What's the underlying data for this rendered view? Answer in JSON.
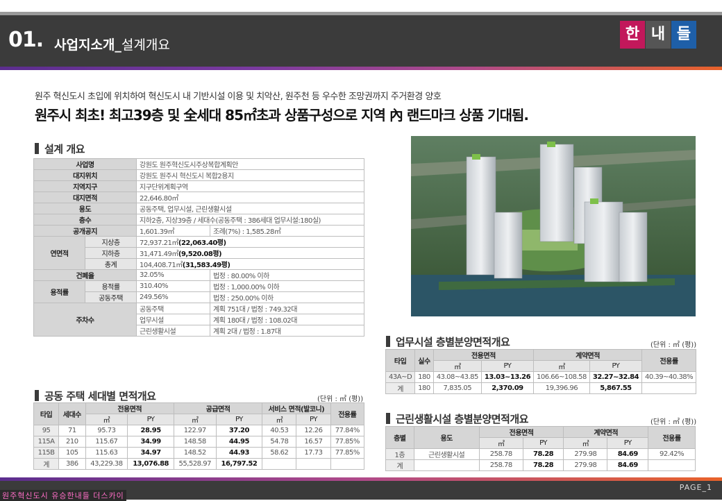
{
  "header": {
    "number": "01.",
    "title": "사업지소개_",
    "subtitle": "설계개요",
    "logo": [
      "한",
      "내",
      "들"
    ]
  },
  "intro": {
    "line1": "원주 혁신도시 초입에 위치하여 혁신도시 내 기반시설 이용 및 치악산, 원주천 등 우수한 조망권까지 주거환경 양호",
    "line2": "원주시 최초! 최고39층 및 全세대 85㎡초과 상품구성으로 지역 內 랜드마크 상품 기대됨."
  },
  "overview": {
    "title": "설계 개요",
    "rows": [
      {
        "label": "사업명",
        "value": "강원도 원주혁신도시주상복합계획안"
      },
      {
        "label": "대지위치",
        "value": "강원도 원주시 혁신도시 복합2용지"
      },
      {
        "label": "지역지구",
        "value": "지구단위계획구역"
      },
      {
        "label": "대지면적",
        "value": "22,646.80㎡"
      },
      {
        "label": "용도",
        "value": "공동주택, 업무시설, 근린생활시설"
      },
      {
        "label": "층수",
        "value": "지하2층, 지상39층 / 세대수(공동주택 : 386세대 업무시설:180실)"
      }
    ],
    "public_space": {
      "label": "공개공지",
      "value": "1,601.39㎡",
      "extra": "조례(7%) : 1,585.28㎡"
    },
    "floor_area": {
      "label": "연면적",
      "items": [
        {
          "label": "지상층",
          "value": "72,937.21㎡",
          "bold": "(22,063.40평)"
        },
        {
          "label": "지하층",
          "value": "31,471.49㎡",
          "bold": "(9,520.08평)"
        },
        {
          "label": "총계",
          "value": "104,408.71㎡",
          "bold": "(31,583.49평)"
        }
      ]
    },
    "coverage": {
      "label": "건폐율",
      "value": "32.05%",
      "legal": "법정 : 80.00% 이하"
    },
    "far": {
      "label": "용적률",
      "items": [
        {
          "label": "용적률",
          "value": "310.40%",
          "legal": "법정 : 1,000.00% 이하"
        },
        {
          "label": "공동주택",
          "value": "249.56%",
          "legal": "법정 : 250.00% 이하"
        }
      ]
    },
    "parking": {
      "label": "주차수",
      "items": [
        {
          "use": "공동주택",
          "value": "계획 751대 / 법정 : 749.32대"
        },
        {
          "use": "업무시설",
          "value": "계획 180대 / 법정 : 108.02대"
        },
        {
          "use": "근린생활시설",
          "value": "계획 2대 / 법정 : 1.87대"
        }
      ]
    }
  },
  "housing": {
    "title": "공동 주택 세대별 면적개요",
    "unit": "(단위 : ㎡ (평))",
    "headers": [
      "타입",
      "세대수",
      "전용면적",
      "공급면적",
      "서비스 면적(발코니)",
      "전용률"
    ],
    "sub": [
      "㎡",
      "PY",
      "㎡",
      "PY",
      "㎡",
      "PY"
    ],
    "rows": [
      [
        "95",
        "71",
        "95.73",
        "28.95",
        "122.97",
        "37.20",
        "40.53",
        "12.26",
        "77.84%"
      ],
      [
        "115A",
        "210",
        "115.67",
        "34.99",
        "148.58",
        "44.95",
        "54.78",
        "16.57",
        "77.85%"
      ],
      [
        "115B",
        "105",
        "115.63",
        "34.97",
        "148.52",
        "44.93",
        "58.62",
        "17.73",
        "77.85%"
      ],
      [
        "계",
        "386",
        "43,229.38",
        "13,076.88",
        "55,528.97",
        "16,797.52",
        "",
        "",
        ""
      ]
    ]
  },
  "office": {
    "title": "업무시설 층별분양면적개요",
    "unit": "(단위 : ㎡ (평))",
    "headers": [
      "타입",
      "실수",
      "전용면적",
      "계약면적",
      "전용률"
    ],
    "sub": [
      "㎡",
      "PY",
      "㎡",
      "PY"
    ],
    "rows": [
      [
        "43A~D",
        "180",
        "43.08~43.85",
        "13.03~13.26",
        "106.66~108.58",
        "32.27~32.84",
        "40.39~40.38%"
      ],
      [
        "계",
        "180",
        "7,835.05",
        "2,370.09",
        "19,396.96",
        "5,867.55",
        ""
      ]
    ]
  },
  "retail": {
    "title": "근린생활시설 층별분양면적개요",
    "unit": "(단위 : ㎡ (평))",
    "headers": [
      "층별",
      "용도",
      "전용면적",
      "계약면적",
      "전용률"
    ],
    "sub": [
      "㎡",
      "PY",
      "㎡",
      "PY"
    ],
    "rows": [
      [
        "1층",
        "근린생활시설",
        "258.78",
        "78.28",
        "279.98",
        "84.69",
        "92.42%"
      ],
      [
        "계",
        "",
        "258.78",
        "78.28",
        "279.98",
        "84.69",
        ""
      ]
    ]
  },
  "footer": {
    "label": "원주혁신도시 유승한내들 더스카이",
    "page": "PAGE_1"
  }
}
